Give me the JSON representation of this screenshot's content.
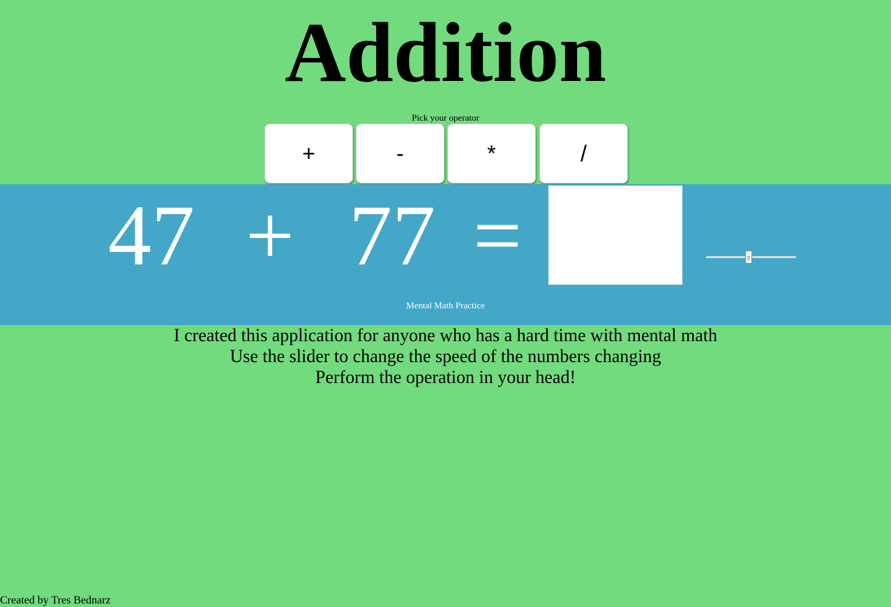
{
  "header": {
    "title": "Addition"
  },
  "operators": {
    "label": "Pick your operator",
    "buttons": [
      "+",
      "-",
      "*",
      "/"
    ]
  },
  "problem": {
    "operand1": "47",
    "operator": "+",
    "operand2": "77",
    "equals": "=",
    "answer_value": ""
  },
  "speed_slider": {
    "value_fraction": 0.47
  },
  "band": {
    "subtitle": "Mental Math Practice"
  },
  "description": {
    "lines": [
      "I created this application for anyone who has a hard time with mental math",
      "Use the slider to change the speed of the numbers changing",
      "Perform the operation in your head!"
    ]
  },
  "footer": {
    "credit": "Created by Tres Bednarz"
  },
  "colors": {
    "page_background": "#72db7e",
    "band_background": "#44a7c8",
    "problem_text": "#ffffff"
  }
}
